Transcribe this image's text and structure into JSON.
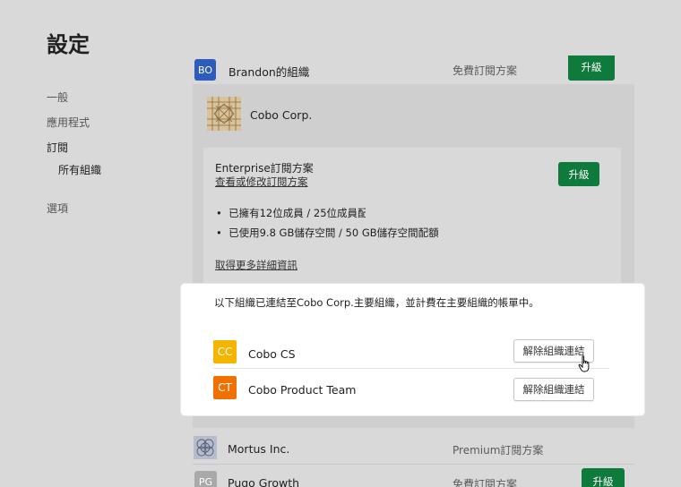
{
  "page": {
    "title": "設定"
  },
  "nav": [
    {
      "label": "一般"
    },
    {
      "label": "應用程式"
    },
    {
      "label": "訂閱"
    },
    {
      "label": "所有組織"
    },
    {
      "label": "選項"
    }
  ],
  "orgs": {
    "brandon": {
      "initials": "BO",
      "name": "Brandon的組織",
      "plan": "免費訂閱方案",
      "button": "升級"
    },
    "cobo": {
      "name": "Cobo Corp."
    },
    "mortus": {
      "name": "Mortus Inc.",
      "plan": "Premium訂閱方案"
    },
    "pugo": {
      "initials": "PG",
      "name": "Pugo Growth",
      "plan": "免費訂閱方案",
      "button": "升級"
    }
  },
  "subscription": {
    "plan_name": "Enterprise訂閱方案",
    "manage_link": "查看或修改訂閱方案",
    "upgrade_button": "升級",
    "bullets": [
      "已擁有12位成員 / 25位成員配額",
      "已使用9.8 GB儲存空間 / 50 GB儲存空間配額"
    ],
    "details_link": "取得更多詳細資訊"
  },
  "linked": {
    "description": "以下組織已連結至Cobo Corp.主要組織，並計費在主要組織的帳單中。",
    "items": [
      {
        "initials": "CC",
        "name": "Cobo CS",
        "button": "解除組織連結"
      },
      {
        "initials": "CT",
        "name": "Cobo Product Team",
        "button": "解除組織連結"
      }
    ]
  },
  "colors": {
    "upgrade_green": "#0e7a3c",
    "brandon_avatar": "#2f5bbd",
    "cobo_cs": "#f5b400",
    "cobo_product": "#f07000",
    "pugo_avatar": "#a9a9a9"
  }
}
